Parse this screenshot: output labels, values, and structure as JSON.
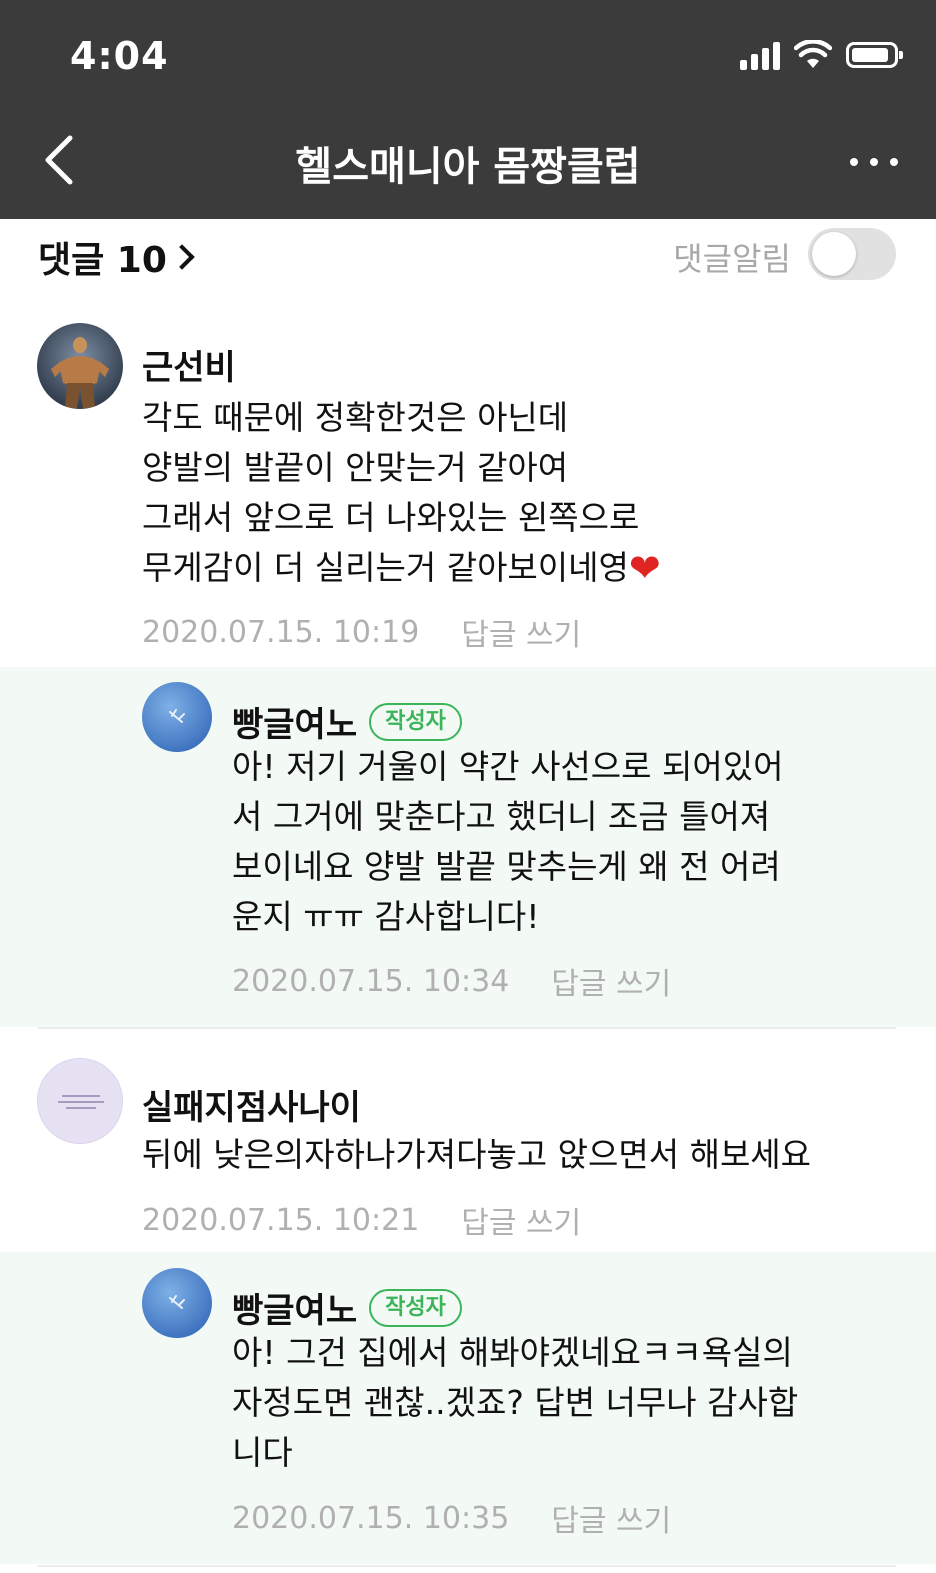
{
  "status_bar": {
    "time": "4:04"
  },
  "nav": {
    "title": "헬스매니아 몸짱클럽",
    "back_icon": "chevron-left-icon",
    "more_icon": "more-horizontal-icon"
  },
  "comments_header": {
    "count_label": "댓글 10",
    "notify_label": "댓글알림",
    "notify_enabled": false
  },
  "colors": {
    "header_bg": "#3b3b3b",
    "reply_bg": "#f3faf5",
    "badge_green": "#3cb55a",
    "meta_gray": "#b0b0b0",
    "heart_red": "#e02323"
  },
  "comments": [
    {
      "author": "근선비",
      "text_lines": [
        "각도 때문에 정확한것은 아닌데",
        "양발의 발끝이 안맞는거 같아여",
        "그래서 앞으로 더 나와있는 왼쪽으로",
        "무게감이 더 실리는거 같아보이네영"
      ],
      "emoji": "❤",
      "date": "2020.07.15. 10:19",
      "reply_label": "답글 쓰기"
    },
    {
      "author": "빵글여노",
      "badge": "작성자",
      "text_lines": [
        "아! 저기 거울이 약간 사선으로 되어있어",
        "서 그거에 맞춘다고 했더니 조금 틀어져",
        "보이네요 양발 발끝 맞추는게 왜 전 어려",
        "운지 ㅠㅠ 감사합니다!"
      ],
      "date": "2020.07.15. 10:34",
      "reply_label": "답글 쓰기"
    },
    {
      "author": "실패지점사나이",
      "text_lines": [
        "뒤에 낮은의자하나가져다놓고 앉으면서 해보세요"
      ],
      "date": "2020.07.15. 10:21",
      "reply_label": "답글 쓰기"
    },
    {
      "author": "빵글여노",
      "badge": "작성자",
      "text_lines": [
        "아! 그건 집에서 해봐야겠네요ㅋㅋ욕실의",
        "자정도면 괜찮..겠죠? 답변 너무나 감사합",
        "니다"
      ],
      "date": "2020.07.15. 10:35",
      "reply_label": "답글 쓰기"
    }
  ]
}
